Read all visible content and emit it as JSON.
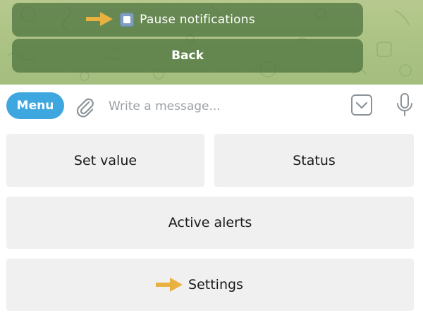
{
  "chat": {
    "inline_buttons": [
      {
        "label": "Pause notifications",
        "emoji": "stop-button-emoji",
        "has_arrow": true
      },
      {
        "label": "Back"
      }
    ]
  },
  "composer": {
    "menu_label": "Menu",
    "placeholder": "Write a message...",
    "icons": [
      "paperclip-icon",
      "keyboard-toggle-icon",
      "microphone-icon"
    ]
  },
  "keyboard": {
    "rows": [
      [
        "Set value",
        "Status"
      ],
      [
        "Active alerts"
      ],
      [
        "Settings"
      ]
    ]
  },
  "colors": {
    "accent": "#3fa7e0",
    "arrow": "#e9b240",
    "inline_button_bg": "#4a703c",
    "keyboard_button_bg": "#f0f0f0"
  }
}
